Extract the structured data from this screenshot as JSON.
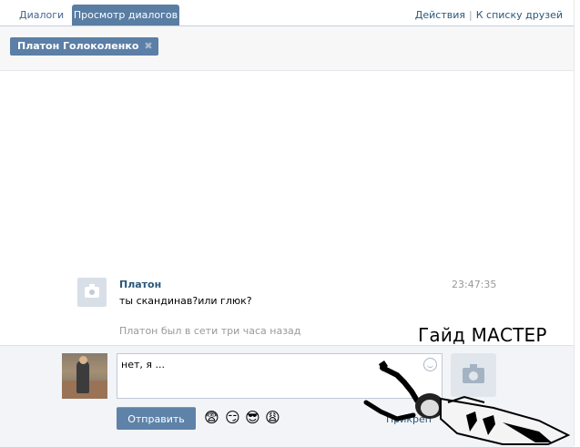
{
  "tabs": {
    "dialogs": "Диалоги",
    "view_dialogs": "Просмотр диалогов"
  },
  "toplinks": {
    "actions": "Действия",
    "separator": "|",
    "friends": "К списку друзей"
  },
  "recipient": {
    "name": "Платон Голоколенко",
    "remove_icon": "close-icon"
  },
  "message": {
    "author": "Платон",
    "text": "ты скандинав?или глюк?",
    "time": "23:47:35"
  },
  "status_note": "Платон был в сети три часа назад",
  "compose": {
    "input_value": "нет, я ...",
    "send_label": "Отправить",
    "attach_label": "Прикреп",
    "emoji": [
      "😨",
      "😏",
      "😎",
      "😩"
    ]
  },
  "overlay_text": "Гайд МАСТЕР",
  "colors": {
    "accent": "#597da3",
    "link": "#2b587a",
    "muted": "#999999"
  }
}
